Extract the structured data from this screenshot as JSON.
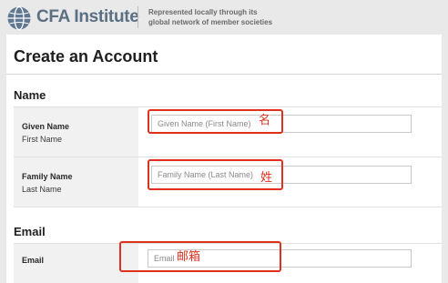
{
  "header": {
    "logo_text": "CFA Institute",
    "tagline_line1": "Represented locally through its",
    "tagline_line2": "global network of member societies"
  },
  "main": {
    "title": "Create an Account",
    "sections": {
      "name": {
        "heading": "Name",
        "fields": [
          {
            "label": "Given Name",
            "sublabel": "First Name",
            "placeholder": "Given Name (First Name)",
            "value": "",
            "annotation": "名"
          },
          {
            "label": "Family Name",
            "sublabel": "Last Name",
            "placeholder": "Family Name (Last Name)",
            "value": "",
            "annotation": "姓"
          }
        ]
      },
      "email": {
        "heading": "Email",
        "fields": [
          {
            "label": "Email",
            "placeholder": "Email",
            "value": "",
            "annotation": "邮箱"
          }
        ]
      }
    }
  },
  "colors": {
    "page_bg": "#e9e9e9",
    "label_bg": "#f1f1f1",
    "logo_text": "#5b6f84",
    "annotation": "#e0301e"
  },
  "icons": {
    "logo": "cfa-globe-logo-icon"
  }
}
